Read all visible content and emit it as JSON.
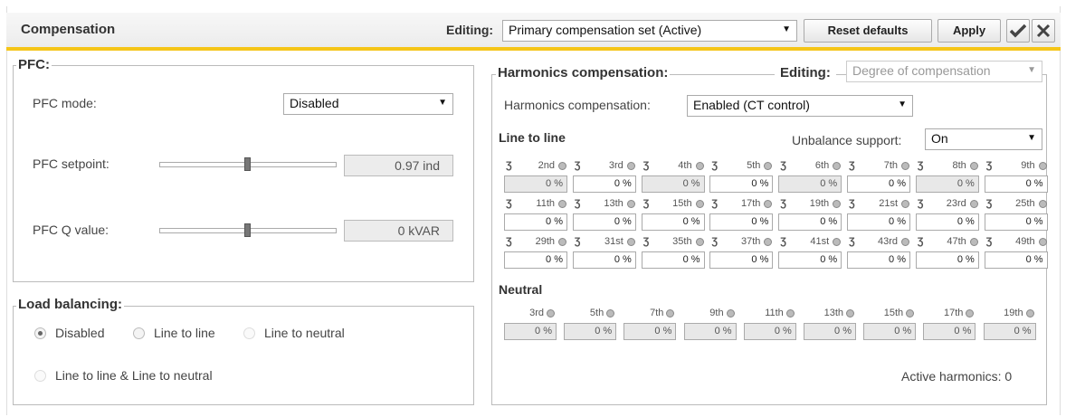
{
  "header": {
    "title": "Compensation",
    "editing_label": "Editing:",
    "editing_value": "Primary compensation set (Active)",
    "reset_label": "Reset defaults",
    "apply_label": "Apply",
    "confirm_icon": "checkmark-icon",
    "close_icon": "close-icon"
  },
  "pfc": {
    "legend": "PFC:",
    "mode_label": "PFC mode:",
    "mode_value": "Disabled",
    "setpoint_label": "PFC setpoint:",
    "setpoint_value": "0.97 ind",
    "setpoint_slider_level": 0.5,
    "q_label": "PFC Q value:",
    "q_value": "0 kVAR",
    "q_slider_level": 0.5
  },
  "load_balancing": {
    "legend": "Load balancing:",
    "options": [
      {
        "label": "Disabled",
        "selected": true,
        "disabled": false
      },
      {
        "label": "Line to line",
        "selected": false,
        "disabled": false
      },
      {
        "label": "Line to neutral",
        "selected": false,
        "disabled": true
      },
      {
        "label": "Line to line & Line to neutral",
        "selected": false,
        "disabled": true
      }
    ]
  },
  "harmonics": {
    "legend": "Harmonics compensation:",
    "editing_label": "Editing:",
    "editing_value": "Degree of compensation",
    "mode_label": "Harmonics compensation:",
    "mode_value": "Enabled (CT control)",
    "line_to_line_title": "Line to line",
    "unbalance_label": "Unbalance support:",
    "unbalance_value": "On",
    "ct_symbol": "Ʒ",
    "line_to_line": [
      {
        "name": "2nd",
        "value": "0 %",
        "disabled": true
      },
      {
        "name": "3rd",
        "value": "0 %",
        "disabled": false
      },
      {
        "name": "4th",
        "value": "0 %",
        "disabled": true
      },
      {
        "name": "5th",
        "value": "0 %",
        "disabled": false
      },
      {
        "name": "6th",
        "value": "0 %",
        "disabled": true
      },
      {
        "name": "7th",
        "value": "0 %",
        "disabled": false
      },
      {
        "name": "8th",
        "value": "0 %",
        "disabled": true
      },
      {
        "name": "9th",
        "value": "0 %",
        "disabled": false
      },
      {
        "name": "11th",
        "value": "0 %",
        "disabled": false
      },
      {
        "name": "13th",
        "value": "0 %",
        "disabled": false
      },
      {
        "name": "15th",
        "value": "0 %",
        "disabled": false
      },
      {
        "name": "17th",
        "value": "0 %",
        "disabled": false
      },
      {
        "name": "19th",
        "value": "0 %",
        "disabled": false
      },
      {
        "name": "21st",
        "value": "0 %",
        "disabled": false
      },
      {
        "name": "23rd",
        "value": "0 %",
        "disabled": false
      },
      {
        "name": "25th",
        "value": "0 %",
        "disabled": false
      },
      {
        "name": "29th",
        "value": "0 %",
        "disabled": false
      },
      {
        "name": "31st",
        "value": "0 %",
        "disabled": false
      },
      {
        "name": "35th",
        "value": "0 %",
        "disabled": false
      },
      {
        "name": "37th",
        "value": "0 %",
        "disabled": false
      },
      {
        "name": "41st",
        "value": "0 %",
        "disabled": false
      },
      {
        "name": "43rd",
        "value": "0 %",
        "disabled": false
      },
      {
        "name": "47th",
        "value": "0 %",
        "disabled": false
      },
      {
        "name": "49th",
        "value": "0 %",
        "disabled": false
      }
    ],
    "neutral_title": "Neutral",
    "neutral": [
      {
        "name": "3rd",
        "value": "0 %"
      },
      {
        "name": "5th",
        "value": "0 %"
      },
      {
        "name": "7th",
        "value": "0 %"
      },
      {
        "name": "9th",
        "value": "0 %"
      },
      {
        "name": "11th",
        "value": "0 %"
      },
      {
        "name": "13th",
        "value": "0 %"
      },
      {
        "name": "15th",
        "value": "0 %"
      },
      {
        "name": "17th",
        "value": "0 %"
      },
      {
        "name": "19th",
        "value": "0 %"
      }
    ],
    "active_label": "Active harmonics: 0"
  }
}
